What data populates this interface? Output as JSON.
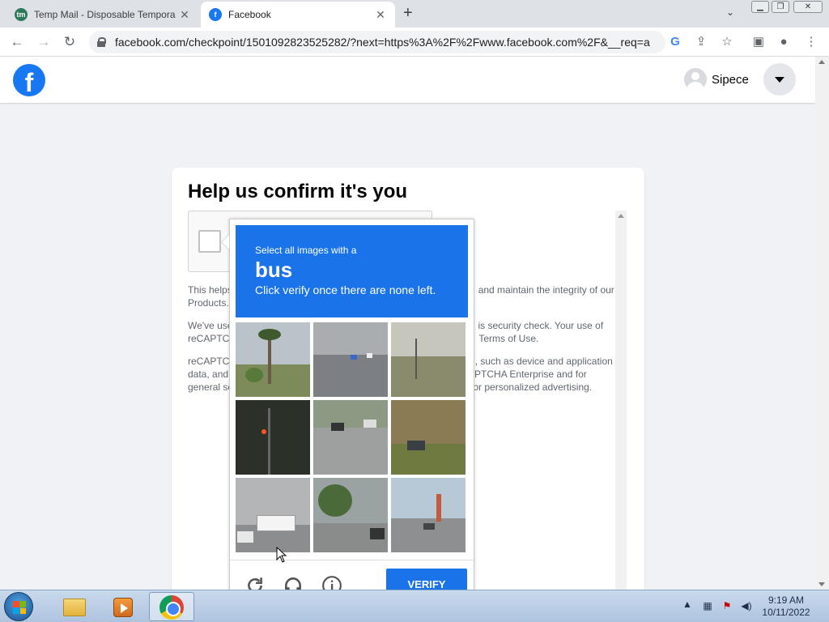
{
  "browser": {
    "tabs": [
      {
        "title": "Temp Mail - Disposable Tempora",
        "favicon": "tempmail-icon"
      },
      {
        "title": "Facebook",
        "favicon": "facebook-icon"
      }
    ],
    "url": "facebook.com/checkpoint/1501092823525282/?next=https%3A%2F%2Fwww.facebook.com%2F&__req=a"
  },
  "header": {
    "logo_letter": "f",
    "profile_name": "Sipece"
  },
  "card": {
    "title": "Help us confirm it's you",
    "para1_left": "This helps",
    "para1_right": "and maintain the integrity of our",
    "para1_line2": "Products.",
    "para2_left": "We've use",
    "para2_right": "is security check. Your use of",
    "para2_l2_left": "reCAPTC",
    "para2_l2_right": "Terms of Use.",
    "para3_left": "reCAPTCH",
    "para3_right": "n, such as device and application",
    "para3_l2_left": "data, and",
    "para3_l2_right": "APTCHA Enterprise and for",
    "para3_l3_left": "general se",
    "para3_l3_right": "for personalized advertising."
  },
  "challenge": {
    "line1": "Select all images with a",
    "word": "bus",
    "line3": "Click verify once there are none left.",
    "verify_label": "VERIFY"
  },
  "taskbar": {
    "time": "9:19 AM",
    "date": "10/11/2022"
  },
  "colors": {
    "facebook_blue": "#1877f2",
    "recaptcha_blue": "#1a73e8"
  }
}
